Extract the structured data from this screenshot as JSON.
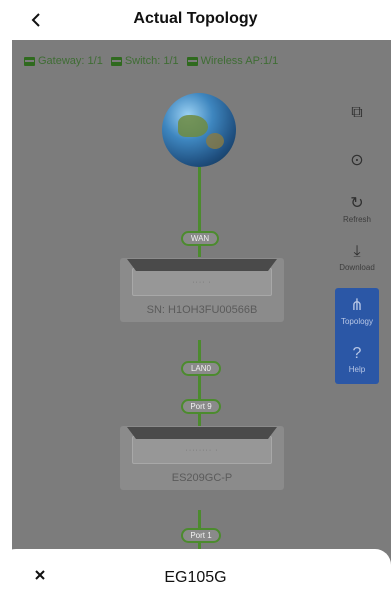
{
  "header": {
    "title": "Actual Topology",
    "back_icon": "chevron-left-icon"
  },
  "counts": [
    {
      "label": "Gateway: 1/1",
      "icon": "gateway-icon"
    },
    {
      "label": "Switch: 1/1",
      "icon": "switch-icon"
    },
    {
      "label": "Wireless AP:1/1",
      "icon": "wireless-ap-icon"
    }
  ],
  "topology": {
    "wan_label": "WAN",
    "gateway": {
      "dots": "···· ·",
      "sn": "SN: H1OH3FU00566B"
    },
    "lan_label": "LAN0",
    "port_label_1": "Port 9",
    "switch": {
      "dots": "········ ·",
      "model": "ES209GC-P"
    },
    "port_label_2": "Port 1"
  },
  "toolbar": {
    "items": [
      {
        "name": "exit-fullscreen-icon",
        "label": ""
      },
      {
        "name": "locate-icon",
        "label": ""
      },
      {
        "name": "refresh-icon",
        "label": "Refresh"
      },
      {
        "name": "download-icon",
        "label": "Download"
      }
    ],
    "active_items": [
      {
        "name": "topology-icon",
        "label": "Topology"
      },
      {
        "name": "help-icon",
        "label": "Help"
      }
    ]
  },
  "sheet": {
    "title": "EG105G",
    "close_icon": "close-icon"
  },
  "colors": {
    "link_green": "#4c8b2e",
    "active_blue": "#2b57a6"
  }
}
